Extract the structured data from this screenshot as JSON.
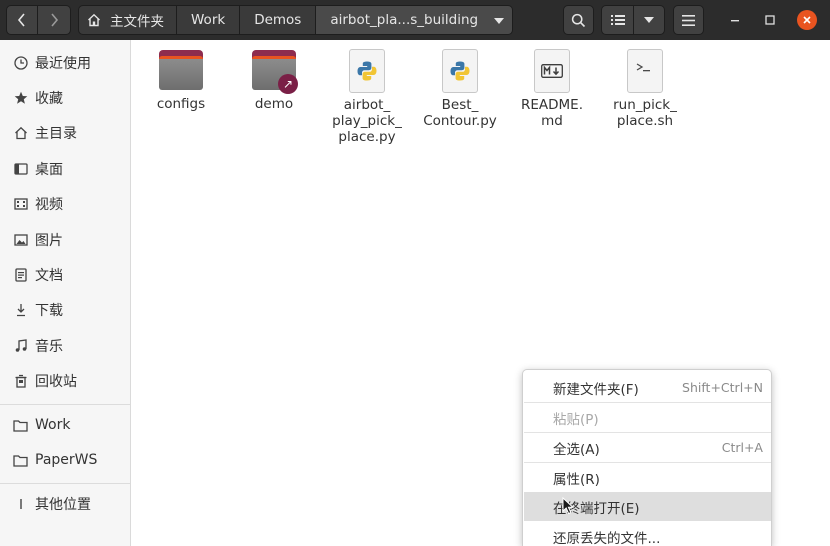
{
  "header": {
    "breadcrumbs": [
      "主文件夹",
      "Work",
      "Demos",
      "airbot_pla...s_building"
    ],
    "icons": {
      "back": "chevron-left-icon",
      "forward": "chevron-right-icon",
      "home": "home-icon",
      "search": "search-icon",
      "view": "list-view-icon",
      "view_options": "chevron-down-icon",
      "menu": "hamburger-menu-icon",
      "minimize": "minimize-icon",
      "maximize": "maximize-icon",
      "close": "close-icon"
    }
  },
  "sidebar": {
    "items": [
      {
        "label": "最近使用",
        "icon": "clock-icon"
      },
      {
        "label": "收藏",
        "icon": "star-icon"
      },
      {
        "label": "主目录",
        "icon": "home-icon"
      },
      {
        "label": "桌面",
        "icon": "desktop-icon"
      },
      {
        "label": "视频",
        "icon": "video-icon"
      },
      {
        "label": "图片",
        "icon": "picture-icon"
      },
      {
        "label": "文档",
        "icon": "document-icon"
      },
      {
        "label": "下载",
        "icon": "download-icon"
      },
      {
        "label": "音乐",
        "icon": "music-icon"
      },
      {
        "label": "回收站",
        "icon": "trash-icon"
      }
    ],
    "bookmarks": [
      {
        "label": "Work",
        "icon": "folder-icon"
      },
      {
        "label": "PaperWS",
        "icon": "folder-icon"
      }
    ],
    "other": {
      "label": "其他位置",
      "icon": "plus-icon"
    }
  },
  "files": [
    {
      "name": "configs",
      "type": "folder"
    },
    {
      "name": "demo",
      "type": "folder-link"
    },
    {
      "name": "airbot_\nplay_pick_\nplace.py",
      "type": "python"
    },
    {
      "name": "Best_\nContour.py",
      "type": "python"
    },
    {
      "name": "README.\nmd",
      "type": "markdown"
    },
    {
      "name": "run_pick_\nplace.sh",
      "type": "shell"
    }
  ],
  "context_menu": {
    "items": [
      {
        "label": "新建文件夹(F)",
        "accel": "Shift+Ctrl+N",
        "enabled": true
      },
      {
        "label": "粘贴(P)",
        "accel": "",
        "enabled": false
      },
      {
        "label": "全选(A)",
        "accel": "Ctrl+A",
        "enabled": true
      },
      {
        "label": "属性(R)",
        "accel": "",
        "enabled": true
      },
      {
        "label": "在终端打开(E)",
        "accel": "",
        "enabled": true
      },
      {
        "label": "还原丢失的文件...",
        "accel": "",
        "enabled": true
      }
    ]
  },
  "colors": {
    "accent": "#e95420",
    "header_bg": "#2c2c2c",
    "folder_tab": "#8e2c4e"
  }
}
